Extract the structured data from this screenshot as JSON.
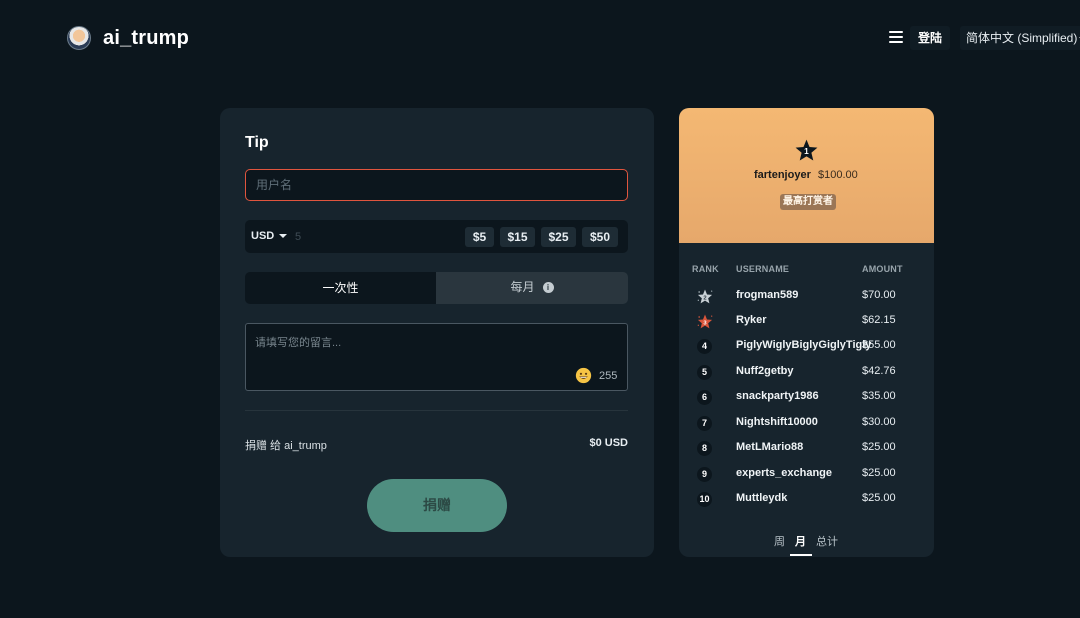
{
  "header": {
    "brand_name": "ai_trump",
    "login_label": "登陆",
    "language": "简体中文 (Simplified)"
  },
  "tip": {
    "title": "Tip",
    "username_placeholder": "用户名",
    "currency": "USD",
    "amount_placeholder": "5",
    "presets": [
      "$5",
      "$15",
      "$25",
      "$50"
    ],
    "frequency_once": "一次性",
    "frequency_monthly": "每月",
    "message_placeholder": "请填写您的留言...",
    "char_count": "255",
    "donate_label": "捐赠 给 ai_trump",
    "donate_total": "$0 USD",
    "donate_button": "捐赠"
  },
  "leaderboard": {
    "top": {
      "rank": "1",
      "username": "fartenjoyer",
      "amount": "$100.00",
      "badge": "最高打赏者"
    },
    "headers": {
      "rank": "RANK",
      "username": "USERNAME",
      "amount": "AMOUNT"
    },
    "rows": [
      {
        "rank": "2",
        "username": "frogman589",
        "amount": "$70.00"
      },
      {
        "rank": "3",
        "username": "Ryker",
        "amount": "$62.15"
      },
      {
        "rank": "4",
        "username": "PiglyWiglyBiglyGiglyTigly",
        "amount": "$55.00"
      },
      {
        "rank": "5",
        "username": "Nuff2getby",
        "amount": "$42.76"
      },
      {
        "rank": "6",
        "username": "snackparty1986",
        "amount": "$35.00"
      },
      {
        "rank": "7",
        "username": "Nightshift10000",
        "amount": "$30.00"
      },
      {
        "rank": "8",
        "username": "MetLMario88",
        "amount": "$25.00"
      },
      {
        "rank": "9",
        "username": "experts_exchange",
        "amount": "$25.00"
      },
      {
        "rank": "10",
        "username": "Muttleydk",
        "amount": "$25.00"
      }
    ],
    "tabs": [
      "周",
      "月",
      "总计"
    ],
    "active_tab": "月"
  },
  "colors": {
    "background": "#0c161d",
    "card": "#17242d",
    "accent_error": "#e0553e",
    "donate_button": "#4f8e80",
    "top_donor_bg": "#f4b873"
  }
}
